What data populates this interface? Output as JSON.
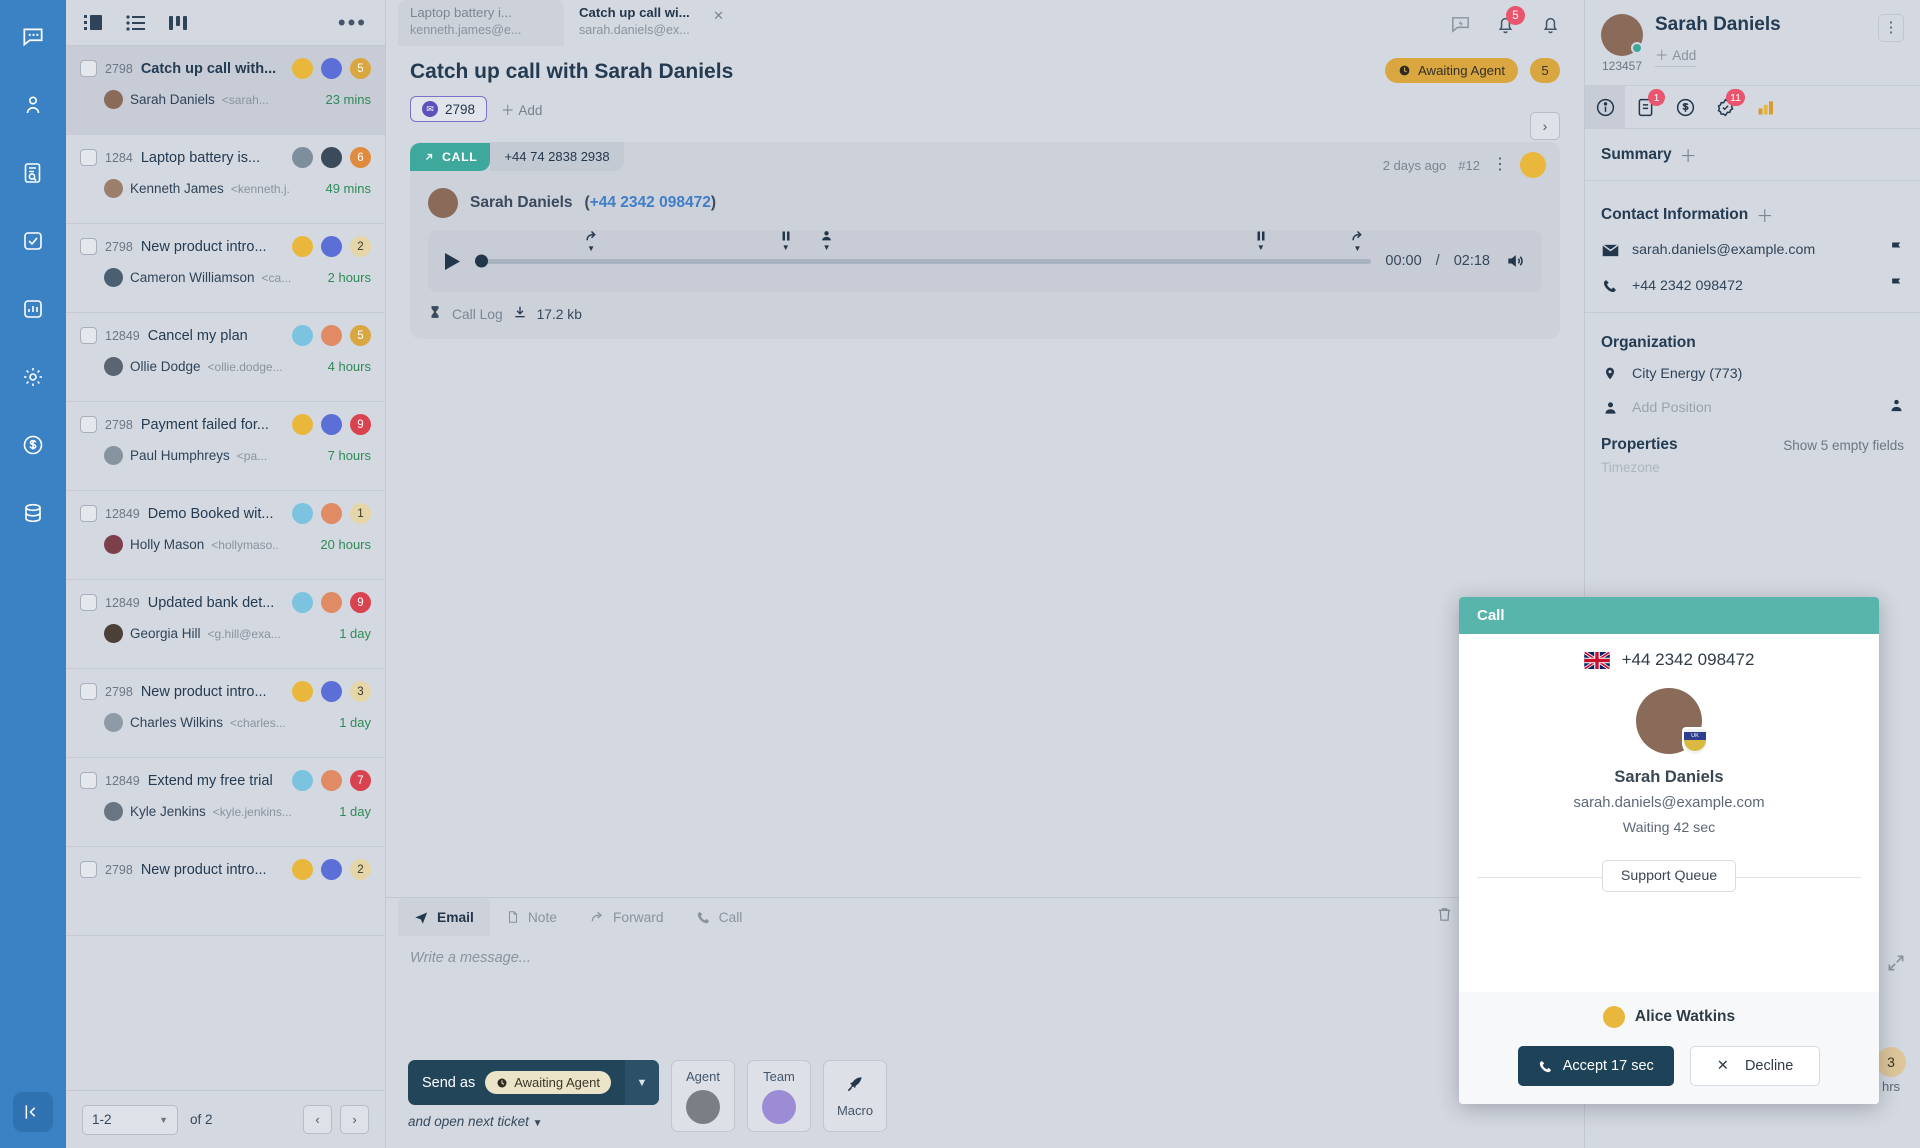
{
  "colors": {
    "rail_bg": "#3b82c4",
    "app_bg": "#d4d8e0",
    "accent_teal": "#3fa89c",
    "modal_header": "#57b5ab",
    "status_amber": "#d9a63f",
    "badge_red": "#e8556d",
    "send_dark": "#234559",
    "link_blue": "#3f7ec9",
    "time_green": "#2e8b57"
  },
  "rail": {
    "items": [
      {
        "name": "chat-icon",
        "label": "Conversations"
      },
      {
        "name": "contacts-icon",
        "label": "Contacts"
      },
      {
        "name": "knowledge-icon",
        "label": "Knowledge Base"
      },
      {
        "name": "tasks-icon",
        "label": "Tasks"
      },
      {
        "name": "reports-icon",
        "label": "Reports"
      },
      {
        "name": "settings-icon",
        "label": "Settings"
      },
      {
        "name": "billing-icon",
        "label": "Billing"
      },
      {
        "name": "storage-icon",
        "label": "Storage"
      }
    ],
    "collapse_label": "Collapse"
  },
  "list_toolbar": {
    "views": [
      "split-view-icon",
      "list-view-icon",
      "board-view-icon"
    ],
    "more_label": "•••"
  },
  "tickets": [
    {
      "id": "2798",
      "subject": "Catch up call with...",
      "contact": "Sarah Daniels",
      "email": "<sarah...",
      "time": "23 mins",
      "count": "5",
      "count_color": "#d9a63f",
      "avatar1": "#e8b73c",
      "avatar2": "#5b6fd6",
      "contact_avatar": "#8a6b5a",
      "active": true
    },
    {
      "id": "1284",
      "subject": "Laptop battery is...",
      "contact": "Kenneth James",
      "email": "<kenneth.j.",
      "time": "49 mins",
      "count": "6",
      "count_color": "#e08b3c",
      "avatar1": "#7e8e9c",
      "avatar2": "#3b4b5c",
      "contact_avatar": "#9c7f6a",
      "active": false
    },
    {
      "id": "2798",
      "subject": "New product intro...",
      "contact": "Cameron Williamson",
      "email": "<ca...",
      "time": "2 hours",
      "count": "2",
      "count_color": "#e5d6a8",
      "avatar1": "#e8b73c",
      "avatar2": "#5b6fd6",
      "contact_avatar": "#4a6070",
      "active": false
    },
    {
      "id": "12849",
      "subject": "Cancel my plan",
      "contact": "Ollie Dodge",
      "email": "<ollie.dodge...",
      "time": "4 hours",
      "count": "5",
      "count_color": "#d9a63f",
      "avatar1": "#7cc3e0",
      "avatar2": "#e08b63",
      "contact_avatar": "#5a6472",
      "active": false
    },
    {
      "id": "2798",
      "subject": "Payment failed for...",
      "contact": "Paul Humphreys",
      "email": "<pa...",
      "time": "7 hours",
      "count": "9",
      "count_color": "#d9434f",
      "avatar1": "#e8b73c",
      "avatar2": "#5b6fd6",
      "contact_avatar": "#86949f",
      "active": false
    },
    {
      "id": "12849",
      "subject": "Demo Booked wit...",
      "contact": "Holly Mason",
      "email": "<hollymaso..",
      "time": "20 hours",
      "count": "1",
      "count_color": "#e5d6a8",
      "avatar1": "#7cc3e0",
      "avatar2": "#e08b63",
      "contact_avatar": "#7e3f4c",
      "active": false
    },
    {
      "id": "12849",
      "subject": "Updated bank det...",
      "contact": "Georgia Hill",
      "email": "<g.hill@exa...",
      "time": "1 day",
      "count": "9",
      "count_color": "#d9434f",
      "avatar1": "#7cc3e0",
      "avatar2": "#e08b63",
      "contact_avatar": "#4a4038",
      "active": false
    },
    {
      "id": "2798",
      "subject": "New product intro...",
      "contact": "Charles Wilkins",
      "email": "<charles...",
      "time": "1 day",
      "count": "3",
      "count_color": "#e5d6a8",
      "avatar1": "#e8b73c",
      "avatar2": "#5b6fd6",
      "contact_avatar": "#8e9aa6",
      "active": false
    },
    {
      "id": "12849",
      "subject": "Extend my free trial",
      "contact": "Kyle Jenkins",
      "email": "<kyle.jenkins...",
      "time": "1 day",
      "count": "7",
      "count_color": "#d9434f",
      "avatar1": "#7cc3e0",
      "avatar2": "#e08b63",
      "contact_avatar": "#6a7583",
      "active": false
    },
    {
      "id": "2798",
      "subject": "New product intro...",
      "contact": "",
      "email": "",
      "time": "",
      "count": "2",
      "count_color": "#e5d6a8",
      "avatar1": "#e8b73c",
      "avatar2": "#5b6fd6",
      "contact_avatar": "#8e9aa6",
      "active": false
    }
  ],
  "pagination": {
    "range": "1-2",
    "of_label": "of 2",
    "prev": "‹",
    "next": "›"
  },
  "tabs": [
    {
      "title": "Laptop battery i...",
      "subtitle": "kenneth.james@e...",
      "active": false
    },
    {
      "title": "Catch up call wi...",
      "subtitle": "sarah.daniels@ex...",
      "active": true
    }
  ],
  "top_icons": [
    {
      "name": "quick-actions-icon",
      "badge": ""
    },
    {
      "name": "notifications-icon",
      "badge": "5"
    },
    {
      "name": "alerts-icon",
      "badge": ""
    }
  ],
  "ticket_header": {
    "title": "Catch up call with Sarah Daniels",
    "channel_id": "2798",
    "add_label": "Add",
    "status": "Awaiting Agent",
    "status_count": "5",
    "next_label": "›"
  },
  "message": {
    "type_label": "CALL",
    "from_number": "+44 74 2838 2938",
    "caller_name": "Sarah Daniels",
    "caller_number": "+44 2342 098472",
    "timestamp": "2 days ago",
    "number": "#12",
    "current_time": "00:00",
    "duration": "02:18",
    "time_separator": "/",
    "call_log_label": "Call Log",
    "attachment_size": "17.2 kb"
  },
  "composer": {
    "tabs": [
      {
        "label": "Email",
        "icon": "send-icon",
        "active": true
      },
      {
        "label": "Note",
        "icon": "note-icon",
        "active": false
      },
      {
        "label": "Forward",
        "icon": "forward-icon",
        "active": false
      },
      {
        "label": "Call",
        "icon": "phone-icon",
        "active": false
      }
    ],
    "tools": [
      "trash-icon",
      "expand-icon",
      "text-format-icon",
      "attach-icon"
    ],
    "placeholder": "Write a message...",
    "send_label": "Send as",
    "send_status": "Awaiting Agent",
    "next_ticket_label": "and open next ticket",
    "assign": [
      {
        "label": "Agent",
        "type": "avatar"
      },
      {
        "label": "Team",
        "type": "team"
      },
      {
        "label": "Macro",
        "type": "icon"
      }
    ]
  },
  "contact_panel": {
    "name": "Sarah Daniels",
    "id": "123457",
    "add_label": "Add",
    "tabs": [
      {
        "name": "info-icon",
        "badge": "",
        "active": true
      },
      {
        "name": "notes-icon",
        "badge": "1",
        "active": false
      },
      {
        "name": "billing-icon",
        "badge": "",
        "active": false
      },
      {
        "name": "tasks-icon",
        "badge": "11",
        "active": false
      },
      {
        "name": "chart-icon",
        "badge": "",
        "active": false
      }
    ],
    "summary_title": "Summary",
    "contact_info_title": "Contact Information",
    "email": "sarah.daniels@example.com",
    "phone": "+44 2342 098472",
    "organization_title": "Organization",
    "organization": "City Energy (773)",
    "position_placeholder": "Add Position",
    "properties_title": "Properties",
    "empty_fields_label": "Show 5 empty fields",
    "timezone_label": "Timezone",
    "sla_value": "3",
    "sla_label": "hrs"
  },
  "call_modal": {
    "header": "Call",
    "phone": "+44 2342 098472",
    "country": "GB",
    "name": "Sarah Daniels",
    "email": "sarah.daniels@example.com",
    "waiting": "Waiting 42 sec",
    "queue": "Support Queue",
    "agent": "Alice Watkins",
    "accept_label": "Accept 17 sec",
    "decline_label": "Decline"
  }
}
